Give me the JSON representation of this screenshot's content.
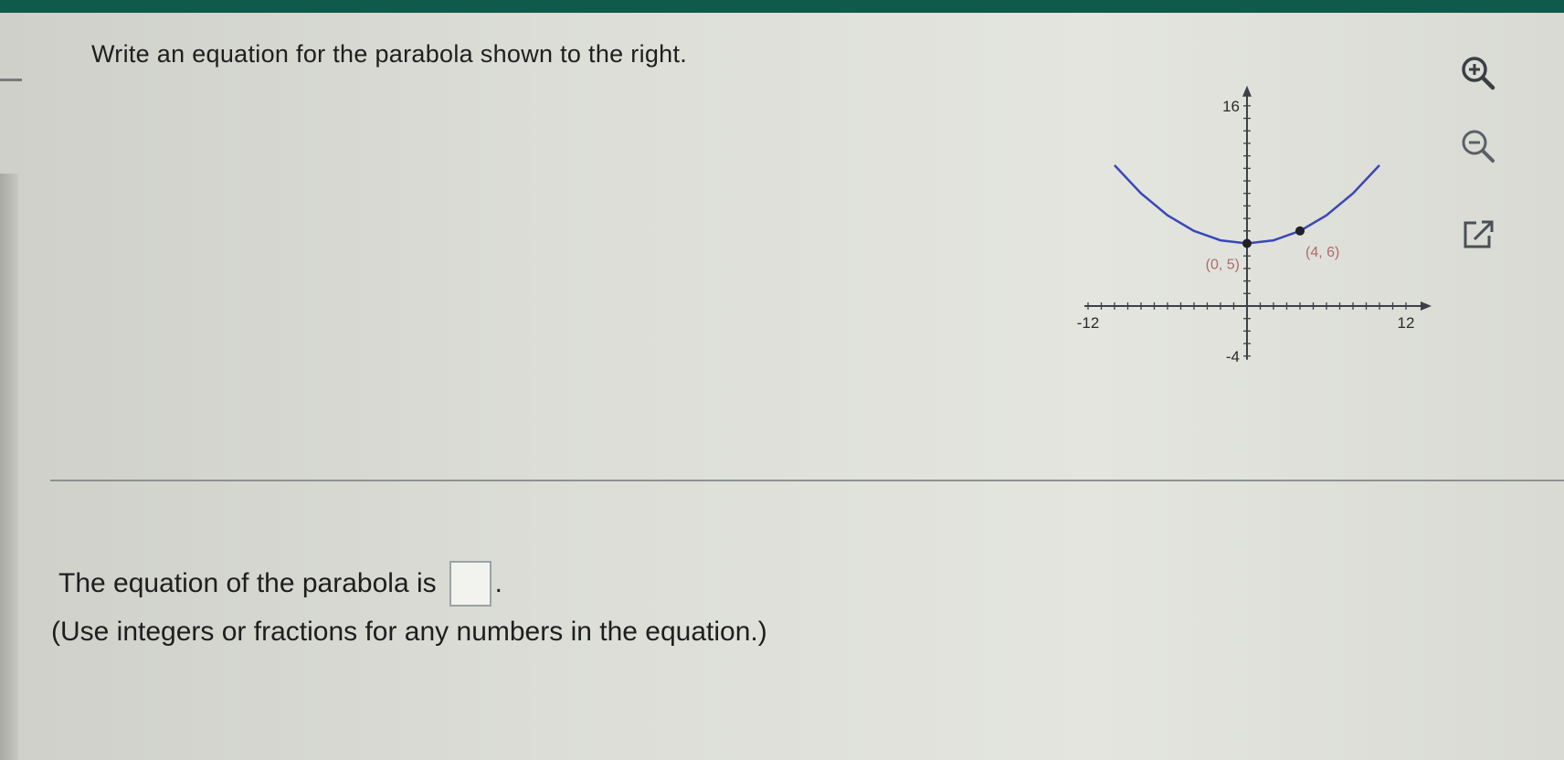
{
  "question": {
    "text": "Write an equation for the parabola shown to the right."
  },
  "graph": {
    "y_max_label": "16",
    "y_min_label": "-4",
    "x_min_label": "-12",
    "x_max_label": "12",
    "point_labels": [
      "(0, 5)",
      "(4, 6)"
    ],
    "curve_color": "#3a47b8",
    "label_color": "#b06a6a"
  },
  "chart_data": {
    "type": "line",
    "title": "",
    "xlabel": "",
    "ylabel": "",
    "xlim": [
      -12,
      12
    ],
    "ylim": [
      -4,
      16
    ],
    "x_tick_labels": [
      "-12",
      "12"
    ],
    "y_tick_labels": [
      "16",
      "-4"
    ],
    "grid": false,
    "series": [
      {
        "x": [
          -10,
          -8,
          -6,
          -4,
          -2,
          0,
          2,
          4,
          6,
          8,
          10
        ],
        "values": [
          11.25,
          9,
          7.25,
          6,
          5.25,
          5,
          5.25,
          6,
          7.25,
          9,
          11.25
        ]
      }
    ],
    "points": [
      {
        "x": 0,
        "y": 5,
        "label": "(0, 5)"
      },
      {
        "x": 4,
        "y": 6,
        "label": "(4, 6)"
      }
    ]
  },
  "tools": {
    "zoom_in_icon": "zoom-in-icon",
    "zoom_out_icon": "zoom-out-icon",
    "popout_icon": "popout-icon"
  },
  "answer": {
    "prefix": "The equation of the parabola is",
    "period": ".",
    "hint": "(Use integers or fractions for any numbers in the equation.)"
  }
}
